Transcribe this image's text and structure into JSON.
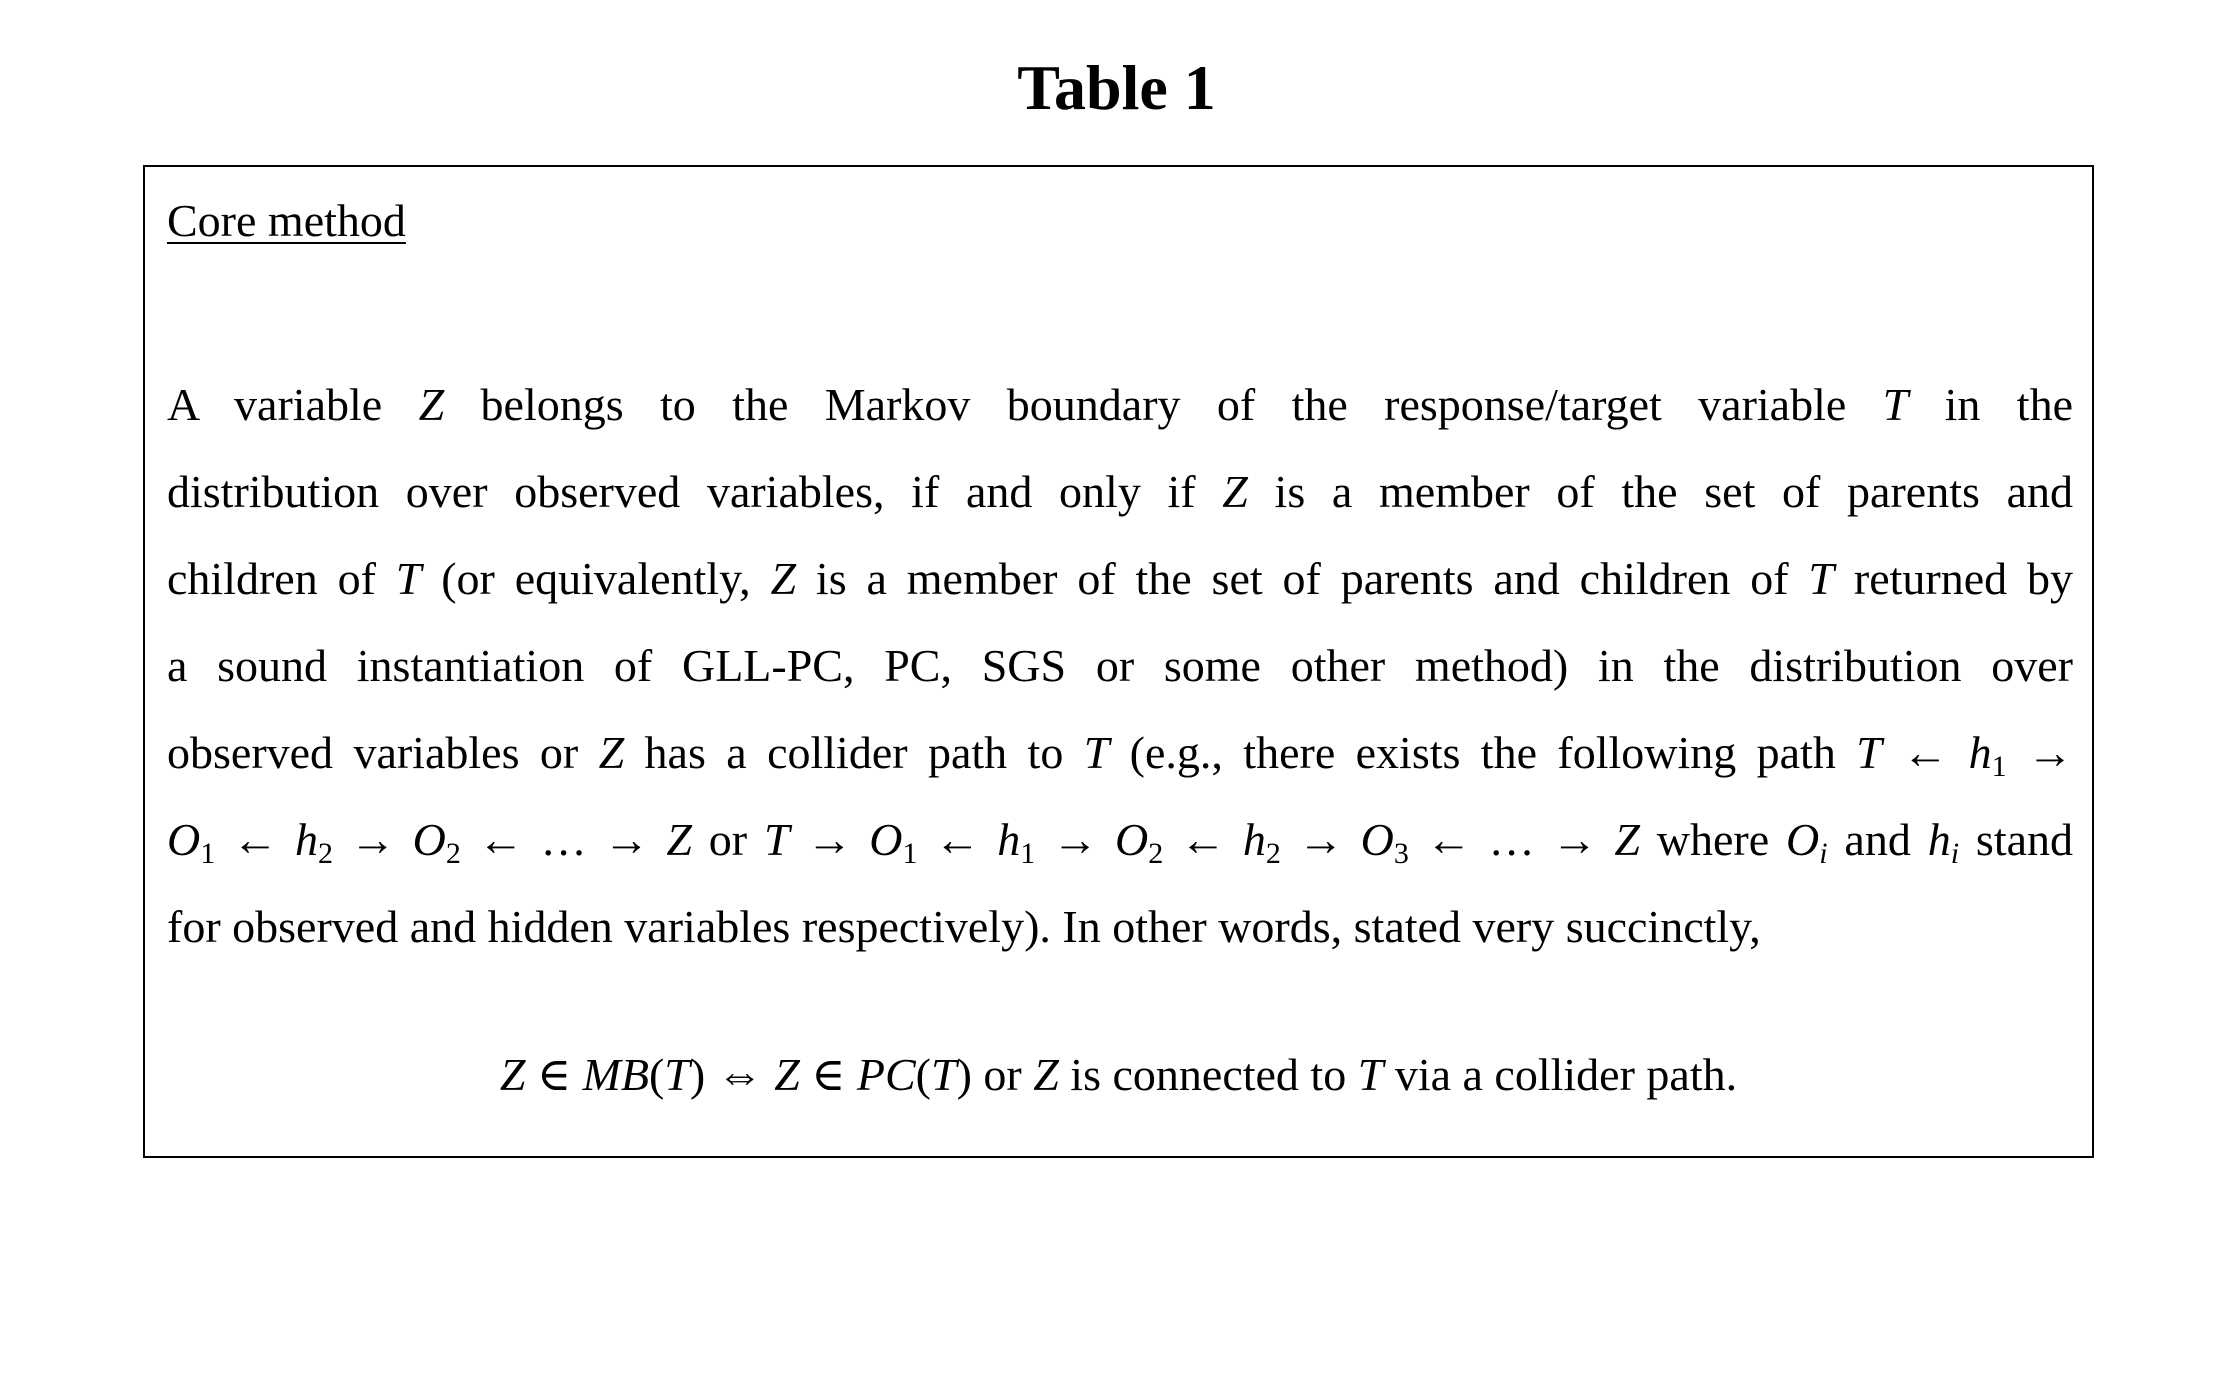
{
  "title": "Table 1",
  "section_heading": "Core method",
  "paragraph_lines": [
    [
      {
        "t": "A  variable  "
      },
      {
        "t": "Z",
        "i": true
      },
      {
        "t": "  belongs  to  the  Markov  boundary  of  the  response/target  variable  "
      },
      {
        "t": "T",
        "i": true
      },
      {
        "t": "  in  the"
      }
    ],
    [
      {
        "t": "distribution over observed variables, if and only if "
      },
      {
        "t": "Z",
        "i": true
      },
      {
        "t": " is a member of the set of parents and"
      }
    ],
    [
      {
        "t": "children of "
      },
      {
        "t": "T",
        "i": true
      },
      {
        "t": " (or equivalently, "
      },
      {
        "t": "Z",
        "i": true
      },
      {
        "t": " is a member of the set of parents and children of "
      },
      {
        "t": "T",
        "i": true
      },
      {
        "t": " returned by"
      }
    ],
    [
      {
        "t": "a sound instantiation of GLL-PC, PC, SGS or some other method) in the distribution over"
      }
    ],
    [
      {
        "t": "observed variables or "
      },
      {
        "t": "Z",
        "i": true
      },
      {
        "t": " has a collider path to "
      },
      {
        "t": "T",
        "i": true
      },
      {
        "t": " (e.g., there exists the following path "
      },
      {
        "t": "T",
        "i": true
      },
      {
        "t": " ← "
      },
      {
        "t": "h",
        "i": true
      },
      {
        "t": "1",
        "sub": true
      },
      {
        "t": " →"
      }
    ],
    [
      {
        "t": "O",
        "i": true
      },
      {
        "t": "1",
        "sub": true
      },
      {
        "t": " ← "
      },
      {
        "t": "h",
        "i": true
      },
      {
        "t": "2",
        "sub": true
      },
      {
        "t": " → "
      },
      {
        "t": "O",
        "i": true
      },
      {
        "t": "2",
        "sub": true
      },
      {
        "t": " ← … → "
      },
      {
        "t": "Z",
        "i": true
      },
      {
        "t": " or "
      },
      {
        "t": "T",
        "i": true
      },
      {
        "t": " → "
      },
      {
        "t": "O",
        "i": true
      },
      {
        "t": "1",
        "sub": true
      },
      {
        "t": " ← "
      },
      {
        "t": "h",
        "i": true
      },
      {
        "t": "1",
        "sub": true
      },
      {
        "t": " → "
      },
      {
        "t": "O",
        "i": true
      },
      {
        "t": "2",
        "sub": true
      },
      {
        "t": " ← "
      },
      {
        "t": "h",
        "i": true
      },
      {
        "t": "2",
        "sub": true
      },
      {
        "t": " → "
      },
      {
        "t": "O",
        "i": true
      },
      {
        "t": "3",
        "sub": true
      },
      {
        "t": " ← … → "
      },
      {
        "t": "Z",
        "i": true
      },
      {
        "t": " where "
      },
      {
        "t": "O",
        "i": true
      },
      {
        "t": "i",
        "sub": true,
        "i": true
      },
      {
        "t": " and "
      },
      {
        "t": "h",
        "i": true
      },
      {
        "t": "i",
        "sub": true,
        "i": true
      },
      {
        "t": " stand"
      }
    ],
    [
      {
        "t": "for observed and hidden variables respectively). In other words, stated very succinctly,"
      }
    ]
  ],
  "formula": [
    {
      "t": "Z",
      "i": true
    },
    {
      "t": " ∈ "
    },
    {
      "t": "MB",
      "i": true
    },
    {
      "t": "("
    },
    {
      "t": "T",
      "i": true
    },
    {
      "t": ") ⇔ "
    },
    {
      "t": "Z",
      "i": true
    },
    {
      "t": " ∈ "
    },
    {
      "t": "PC",
      "i": true
    },
    {
      "t": "("
    },
    {
      "t": "T",
      "i": true
    },
    {
      "t": ") or "
    },
    {
      "t": "Z",
      "i": true
    },
    {
      "t": " is connected to "
    },
    {
      "t": "T",
      "i": true
    },
    {
      "t": " via a collider path."
    }
  ]
}
